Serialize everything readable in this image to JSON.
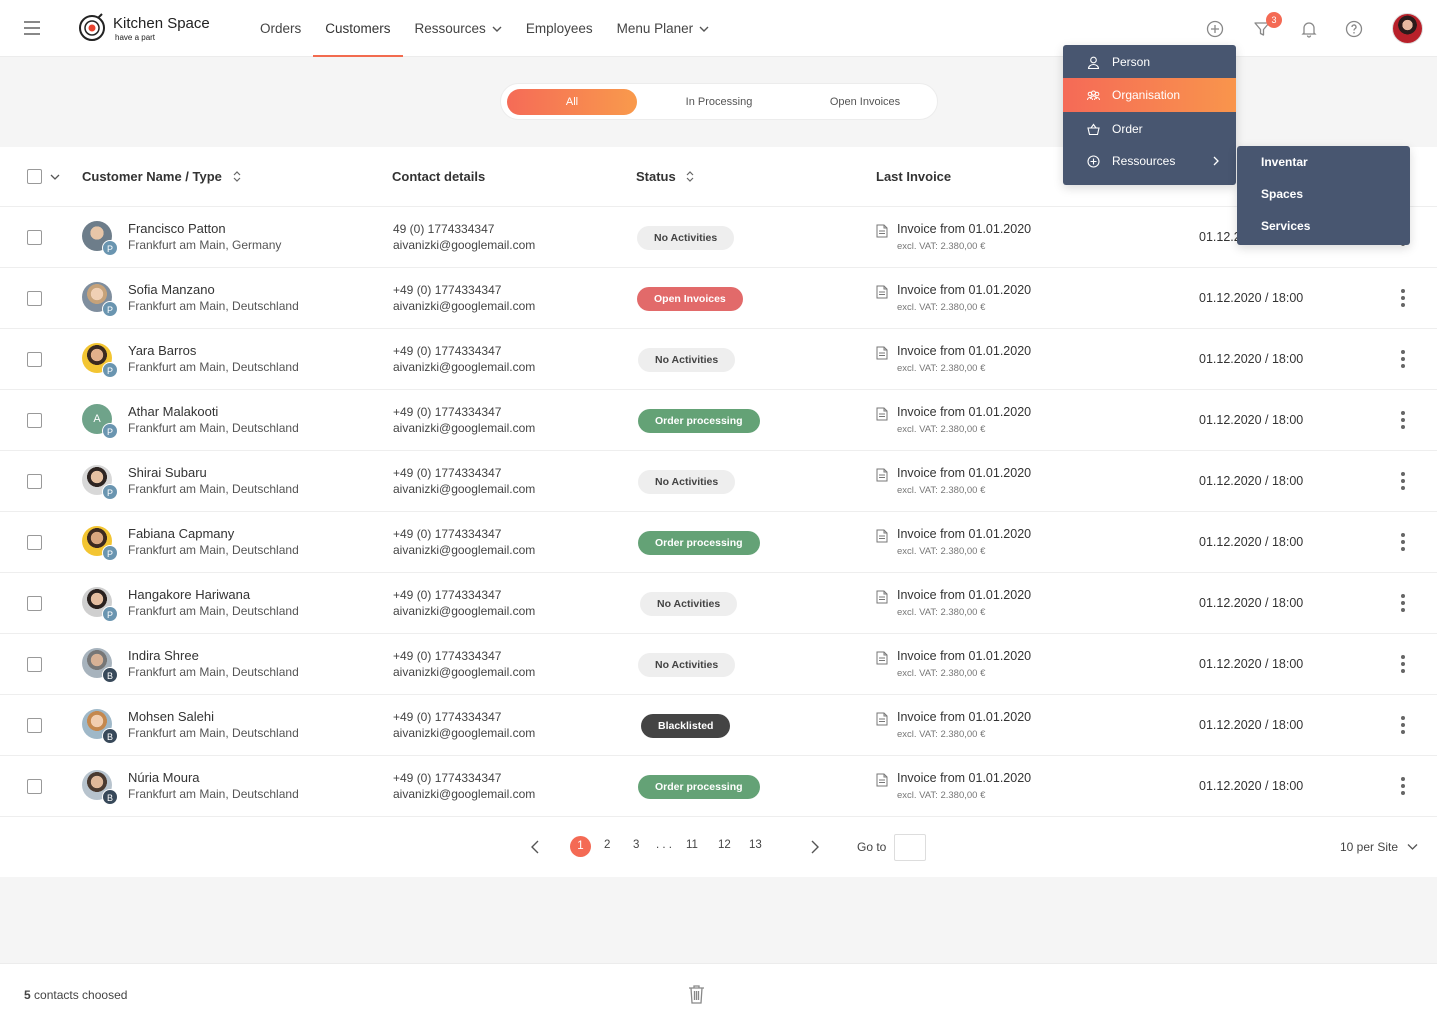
{
  "header": {
    "logo_title": "Kitchen Space",
    "logo_subtitle": "have a part",
    "nav": [
      {
        "label": "Orders"
      },
      {
        "label": "Customers",
        "active": true
      },
      {
        "label": "Ressources",
        "dropdown": true
      },
      {
        "label": "Employees"
      },
      {
        "label": "Menu Planer",
        "dropdown": true
      }
    ],
    "filter_badge": "3",
    "icons": [
      "menu-icon",
      "add-circle-icon",
      "filter-icon",
      "bell-icon",
      "help-icon"
    ],
    "accent_color": "#f46a54"
  },
  "filter_tabs": [
    {
      "label": "All",
      "active": true
    },
    {
      "label": "In Processing"
    },
    {
      "label": "Open Invoices"
    }
  ],
  "table": {
    "columns": {
      "name": "Customer Name / Type",
      "contact": "Contact details",
      "status": "Status",
      "invoice": "Last Invoice"
    },
    "rows": [
      {
        "name": "Francisco Patton",
        "location": "Frankfurt am Main, Germany",
        "phone": " 49 (0) 1774334347",
        "email": "aivanizki@googlemail.com",
        "status": "No Activities",
        "status_type": "none",
        "type": "P",
        "invoice": "Invoice from 01.01.2020",
        "vat": "excl. VAT: 2.380,00 €",
        "date": "01.12.2020 / 18:00"
      },
      {
        "name": "Sofia Manzano",
        "location": "Frankfurt am Main, Deutschland",
        "phone": "+49 (0) 1774334347",
        "email": "aivanizki@googlemail.com",
        "status": "Open Invoices",
        "status_type": "open",
        "type": "P",
        "invoice": "Invoice from 01.01.2020",
        "vat": "excl. VAT: 2.380,00 €",
        "date": "01.12.2020 / 18:00"
      },
      {
        "name": "Yara Barros",
        "location": "Frankfurt am Main, Deutschland",
        "phone": "+49 (0) 1774334347",
        "email": "aivanizki@googlemail.com",
        "status": "No Activities",
        "status_type": "none",
        "type": "P",
        "invoice": "Invoice from 01.01.2020",
        "vat": "excl. VAT: 2.380,00 €",
        "date": "01.12.2020 / 18:00"
      },
      {
        "name": "Athar Malakooti",
        "location": "Frankfurt am Main, Deutschland",
        "phone": "+49 (0) 1774334347",
        "email": "aivanizki@googlemail.com",
        "status": "Order processing",
        "status_type": "proc",
        "type": "P",
        "initial": "A",
        "invoice": "Invoice from 01.01.2020",
        "vat": "excl. VAT: 2.380,00 €",
        "date": "01.12.2020 / 18:00"
      },
      {
        "name": "Shirai Subaru",
        "location": "Frankfurt am Main, Deutschland",
        "phone": "+49 (0) 1774334347",
        "email": "aivanizki@googlemail.com",
        "status": "No Activities",
        "status_type": "none",
        "type": "P",
        "invoice": "Invoice from 01.01.2020",
        "vat": "excl. VAT: 2.380,00 €",
        "date": "01.12.2020 / 18:00"
      },
      {
        "name": "Fabiana Capmany",
        "location": "Frankfurt am Main, Deutschland",
        "phone": "+49 (0) 1774334347",
        "email": "aivanizki@googlemail.com",
        "status": "Order processing",
        "status_type": "proc",
        "type": "P",
        "invoice": "Invoice from 01.01.2020",
        "vat": "excl. VAT: 2.380,00 €",
        "date": "01.12.2020 / 18:00"
      },
      {
        "name": "Hangakore Hariwana",
        "location": "Frankfurt am Main, Deutschland",
        "phone": "+49 (0) 1774334347",
        "email": "aivanizki@googlemail.com",
        "status": "No Activities",
        "status_type": "none",
        "type": "P",
        "invoice": "Invoice from 01.01.2020",
        "vat": "excl. VAT: 2.380,00 €",
        "date": "01.12.2020 / 18:00"
      },
      {
        "name": "Indira Shree",
        "location": "Frankfurt am Main, Deutschland",
        "phone": "+49 (0) 1774334347",
        "email": "aivanizki@googlemail.com",
        "status": "No Activities",
        "status_type": "none",
        "type": "B",
        "invoice": "Invoice from 01.01.2020",
        "vat": "excl. VAT: 2.380,00 €",
        "date": "01.12.2020 / 18:00"
      },
      {
        "name": "Mohsen Salehi",
        "location": "Frankfurt am Main, Deutschland",
        "phone": "+49 (0) 1774334347",
        "email": "aivanizki@googlemail.com",
        "status": "Blacklisted",
        "status_type": "black",
        "type": "B",
        "invoice": "Invoice from 01.01.2020",
        "vat": "excl. VAT: 2.380,00 €",
        "date": "01.12.2020 / 18:00"
      },
      {
        "name": "Núria Moura",
        "location": "Frankfurt am Main, Deutschland",
        "phone": "+49 (0) 1774334347",
        "email": "aivanizki@googlemail.com",
        "status": "Order processing",
        "status_type": "proc",
        "type": "B",
        "invoice": "Invoice from 01.01.2020",
        "vat": "excl. VAT: 2.380,00 €",
        "date": "01.12.2020 / 18:00"
      }
    ]
  },
  "pagination": {
    "pages": [
      "1",
      "2",
      "3",
      ". . .",
      "11",
      "12",
      "13"
    ],
    "current": "1",
    "goto_label": "Go to",
    "goto_value": "",
    "per_page": "10 per Site"
  },
  "footer": {
    "count": "5",
    "count_label": "contacts choosed"
  },
  "add_menu": {
    "items": [
      {
        "label": "Person",
        "icon": "person-icon"
      },
      {
        "label": "Organisation",
        "icon": "organisation-icon",
        "active": true
      },
      {
        "label": "Order",
        "icon": "basket-icon"
      },
      {
        "label": "Ressources",
        "icon": "add-circle-icon",
        "submenu": true
      }
    ],
    "submenu": [
      "Inventar",
      "Spaces",
      "Services"
    ]
  },
  "status_colors": {
    "none": "#eeeeee",
    "open": "#e26a6a",
    "proc": "#64a276",
    "black": "#444444"
  }
}
